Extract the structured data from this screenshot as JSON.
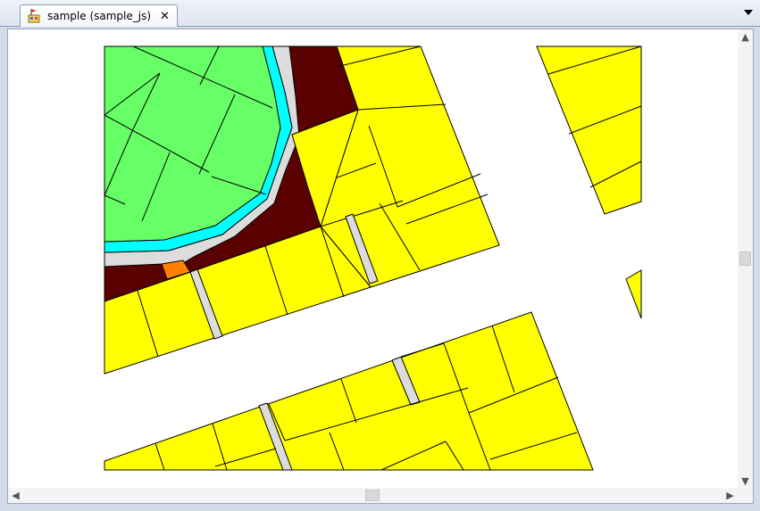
{
  "tab": {
    "label": "sample (sample_js)",
    "close_glyph": "✕",
    "icon": "map-document-icon"
  },
  "colors": {
    "park": "#66ff66",
    "water": "#00ffff",
    "path": "#dcdcdc",
    "parcel": "#ffff00",
    "dark": "#5a0000",
    "orange": "#ff8000",
    "outline": "#000000"
  },
  "scrollbars": {
    "up": "▲",
    "down": "▼",
    "left": "◀",
    "right": "▶"
  }
}
